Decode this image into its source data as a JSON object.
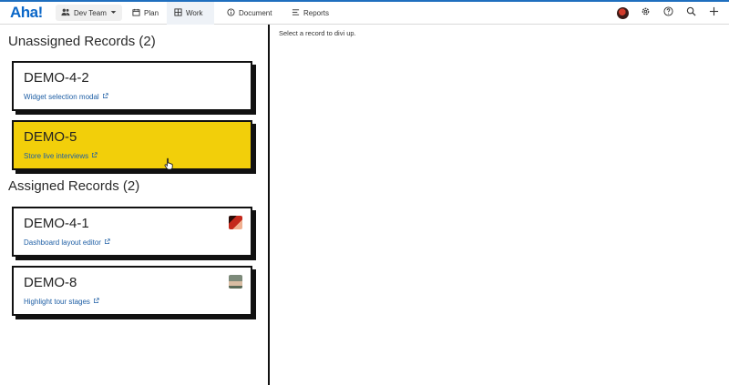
{
  "app": {
    "logo": "Aha!",
    "team": "Dev Team",
    "tabs": [
      {
        "label": "Plan"
      },
      {
        "label": "Work"
      },
      {
        "label": "Document"
      },
      {
        "label": "Reports"
      }
    ],
    "active_tab": "Work",
    "tools": [
      "user-avatar",
      "settings-icon",
      "help-icon",
      "search-icon",
      "add-icon"
    ]
  },
  "main": {
    "hint": "Select a record to divi up.",
    "unassigned_title": "Unassigned Records (2)",
    "assigned_title": "Assigned Records (2)",
    "unassigned": [
      {
        "key": "DEMO-4-2",
        "name": "Widget selection modal"
      },
      {
        "key": "DEMO-5",
        "name": "Store live interviews"
      }
    ],
    "assigned": [
      {
        "key": "DEMO-4-1",
        "name": "Dashboard layout editor"
      },
      {
        "key": "DEMO-8",
        "name": "Highlight tour stages"
      }
    ]
  },
  "colors": {
    "brand": "#0a67c8",
    "highlight": "#f2cf0a",
    "link": "#1f5fa5"
  }
}
